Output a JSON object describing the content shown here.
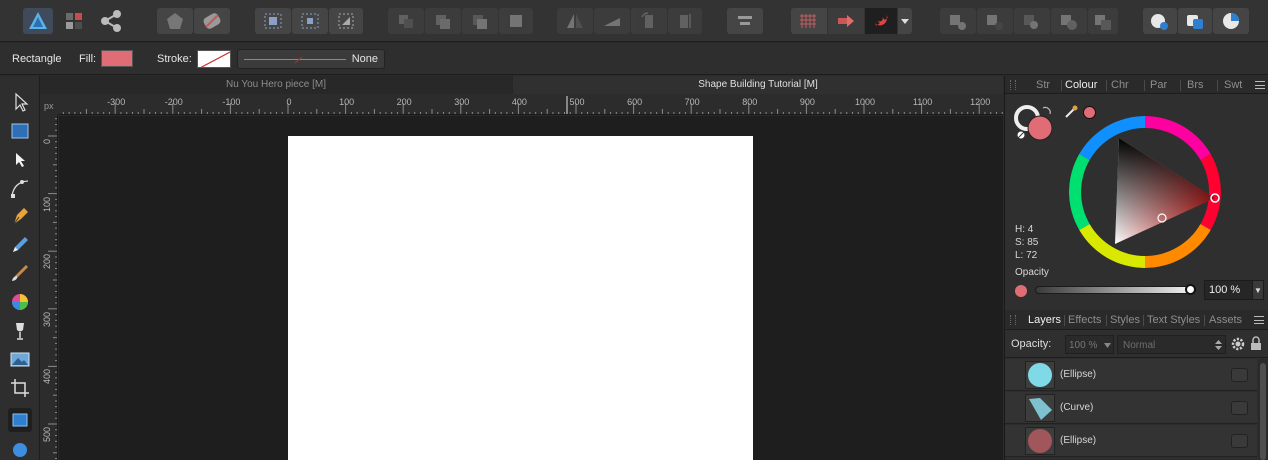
{
  "context_toolbar": {
    "tool_name": "Rectangle",
    "fill_label": "Fill:",
    "fill_color": "#e06c75",
    "stroke_label": "Stroke:",
    "stroke_width_value": "None"
  },
  "document_tabs": [
    {
      "label": "Nu You Hero piece [M]",
      "active": false
    },
    {
      "label": "Shape Building Tutorial [M]",
      "active": true
    }
  ],
  "ruler": {
    "unit": "px",
    "horizontal_labels": [
      "-300",
      "-200",
      "-100",
      "0",
      "100",
      "200",
      "300",
      "400",
      "500",
      "600",
      "700",
      "800",
      "900",
      "1000",
      "1100",
      "1200"
    ],
    "vertical_labels": [
      "0",
      "100",
      "200",
      "300",
      "400",
      "500"
    ]
  },
  "colour_panel": {
    "tabs": [
      "Str",
      "Colour",
      "Chr",
      "Par",
      "Brs",
      "Swt"
    ],
    "active_tab": "Colour",
    "h_label": "H: 4",
    "s_label": "S: 85",
    "l_label": "L: 72",
    "opacity_label": "Opacity",
    "opacity_value": "100 %",
    "current_color": "#e06c75"
  },
  "layers_panel": {
    "tabs": [
      "Layers",
      "Effects",
      "Styles",
      "Text Styles",
      "Assets"
    ],
    "active_tab": "Layers",
    "opacity_label": "Opacity:",
    "opacity_value": "100 %",
    "blend_mode": "Normal",
    "layers": [
      {
        "name": "(Ellipse)",
        "thumb_color": "#7fd9e6"
      },
      {
        "name": "(Curve)",
        "thumb_color": "#7fc2cf"
      },
      {
        "name": "(Ellipse)",
        "thumb_color": "#a0565b"
      }
    ]
  },
  "icons": {
    "app_logo": "affinity-designer-logo-icon",
    "persona_pixel": "pixel-persona-icon",
    "persona_export": "export-persona-icon"
  }
}
